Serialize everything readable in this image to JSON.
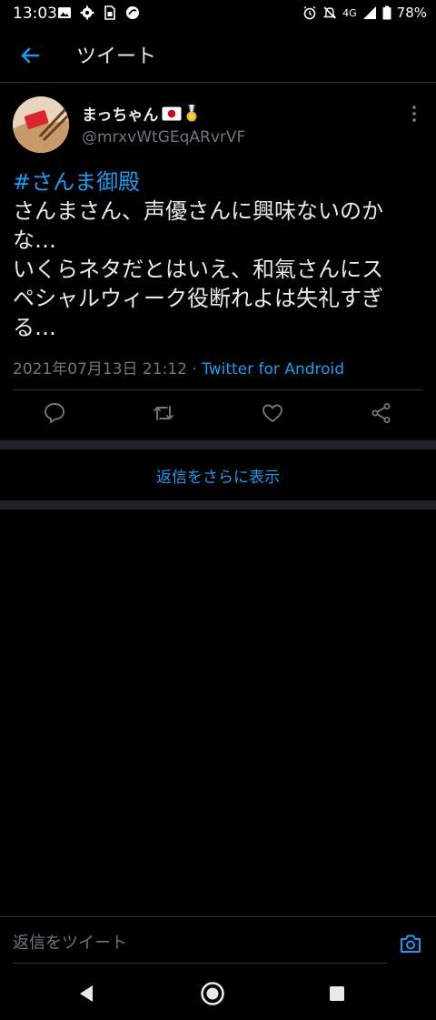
{
  "status_bar": {
    "time": "13:03",
    "network": "4G",
    "battery": "78%"
  },
  "header": {
    "title": "ツイート"
  },
  "tweet": {
    "display_name": "まっちゃん",
    "handle": "@mrxvWtGEqARvrVF",
    "hashtag": "#さんま御殿",
    "text_lines": [
      "さんまさん、声優さんに興味ないのか",
      "な…",
      "いくらネタだとはいえ、和氣さんにス",
      "ペシャルウィーク役断れよは失礼すぎ",
      "る…"
    ],
    "timestamp": "2021年07月13日 21:12",
    "separator": " · ",
    "source": "Twitter for Android"
  },
  "show_more_replies": "返信をさらに表示",
  "reply_bar": {
    "placeholder": "返信をツイート"
  },
  "colors": {
    "accent": "#1d9bf0",
    "background": "#000000",
    "secondary_text": "#71767b"
  }
}
